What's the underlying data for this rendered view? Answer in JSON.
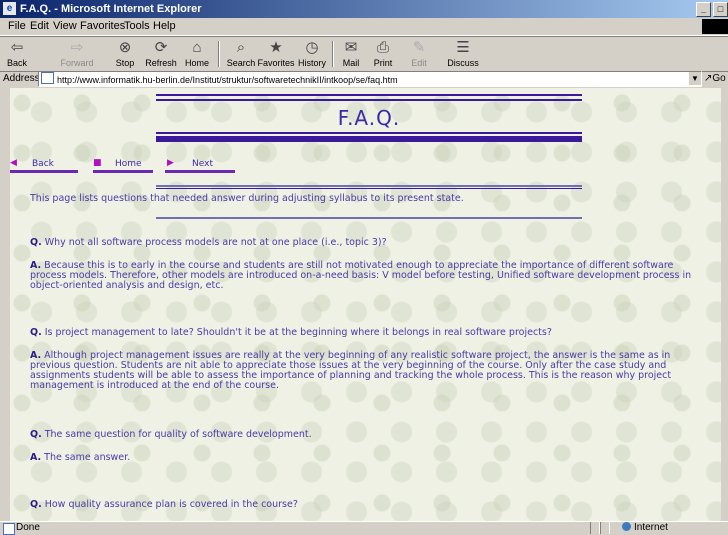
{
  "window": {
    "title": "F.A.Q. - Microsoft Internet Explorer"
  },
  "menu": [
    "File",
    "Edit",
    "View",
    "Favorites",
    "Tools",
    "Help"
  ],
  "toolbar": {
    "back": "Back",
    "forward": "Forward",
    "stop": "Stop",
    "refresh": "Refresh",
    "home": "Home",
    "search": "Search",
    "favorites": "Favorites",
    "history": "History",
    "mail": "Mail",
    "print": "Print",
    "edit": "Edit",
    "discuss": "Discuss"
  },
  "address": {
    "label": "Address",
    "url": "http://www.informatik.hu-berlin.de/Institut/struktur/softwaretechnikII/intkoop/se/faq.htm",
    "go": "Go"
  },
  "page": {
    "title": "F.A.Q.",
    "nav": {
      "back": "Back",
      "home": "Home",
      "next": "Next"
    },
    "intro": "This page lists questions that needed answer during adjusting syllabus to its present state.",
    "q_prefix": "Q.",
    "a_prefix": "A.",
    "faqs": [
      {
        "q": "Why not all software process models are not at one place (i.e., topic 3)?",
        "a": "Because this is to early in the course and students are still not motivated enough to appreciate the importance of different software process models. Therefore, other models are introduced on-a-need basis: V model before testing, Unified software development process in object-oriented analysis and design, etc."
      },
      {
        "q": "Is project management to late? Shouldn't it be at the beginning where it belongs in real software projects?",
        "a": "Although project management issues are really at the very beginning of any realistic software project, the answer is the same as in previous question. Students are nit able to appreciate those issues at the very beginning of the course. Only after the case study and assignments students will be able to assess the importance of planning and tracking the whole process. This is the reason why project management is introduced at the end of the course."
      },
      {
        "q": "The same question for quality of software development.",
        "a": "The same answer."
      },
      {
        "q": "How quality assurance plan is covered in the course?",
        "a": ""
      }
    ]
  },
  "status": {
    "text": "Done",
    "zone": "Internet"
  }
}
